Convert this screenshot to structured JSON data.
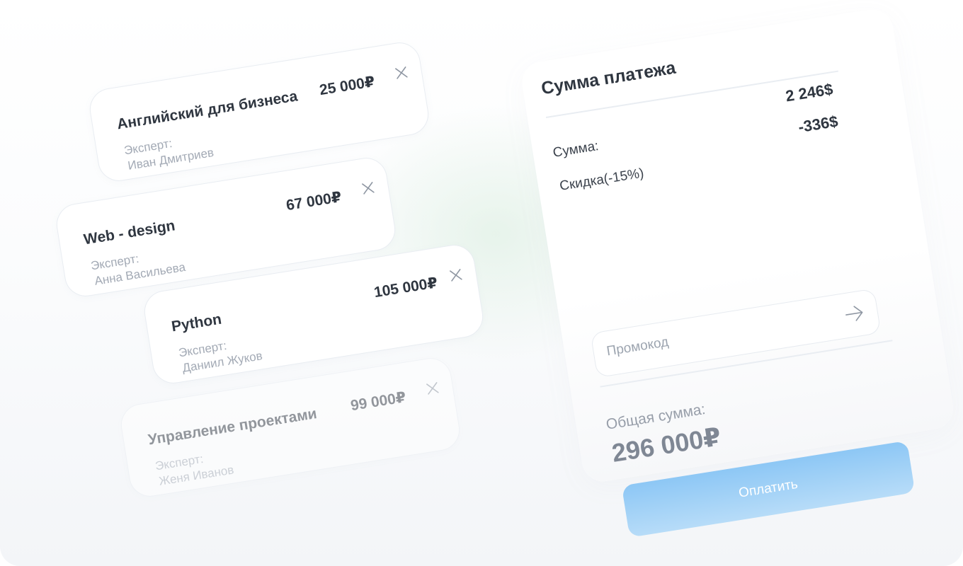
{
  "courses": [
    {
      "title": "Английский для бизнеса",
      "price": "25 000₽",
      "expert_label": "Эксперт:",
      "expert_name": "Иван Дмитриев"
    },
    {
      "title": "Web - design",
      "price": "67 000₽",
      "expert_label": "Эксперт:",
      "expert_name": "Анна Васильева"
    },
    {
      "title": "Python",
      "price": "105 000₽",
      "expert_label": "Эксперт:",
      "expert_name": "Даниил Жуков"
    },
    {
      "title": "Управление проектами",
      "price": "99 000₽",
      "expert_label": "Эксперт:",
      "expert_name": "Женя Иванов"
    }
  ],
  "payment": {
    "title": "Сумма платежа",
    "sum_label": "Сумма:",
    "sum_value": "2 246$",
    "discount_label": "Скидка(-15%)",
    "discount_value": "-336$",
    "promo_placeholder": "Промокод",
    "total_label": "Общая сумма:",
    "total_value": "296 000₽",
    "pay_button": "Оплатить"
  },
  "icons": {
    "remove": "close-icon",
    "submit_promo": "arrow-right-icon"
  },
  "colors": {
    "accent": "#8dc7f5",
    "text_primary": "#2f3640",
    "text_muted": "#a3aab5"
  }
}
